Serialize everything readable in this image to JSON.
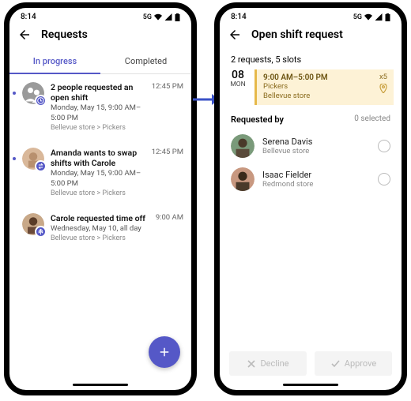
{
  "status": {
    "time": "8:14",
    "net": "5G"
  },
  "left": {
    "title": "Requests",
    "tabs": {
      "inprogress": "In progress",
      "completed": "Completed"
    },
    "items": [
      {
        "title": "2 people requested an open shift",
        "sub": "Monday, May 15, 9:00 AM–5:00 PM",
        "meta": "Bellevue store > Pickers",
        "time": "12:45 PM"
      },
      {
        "title": "Amanda wants to swap shifts with Carole",
        "sub": "Monday, May 15, 9:00 AM–5:00 PM",
        "meta": "Bellevue store > Pickers",
        "time": "12:45 PM"
      },
      {
        "title": "Carole requested time off",
        "sub": "Wednesday, May 10, all day",
        "meta": "Bellevue store > Pickers",
        "time": "9:00 AM"
      }
    ]
  },
  "right": {
    "title": "Open shift request",
    "summary": "2 requests, 5 slots",
    "shift": {
      "daynum": "08",
      "dayname": "MON",
      "time": "9:00 AM–5:00 PM",
      "team": "Pickers",
      "loc": "Bellevue store",
      "count": "x5"
    },
    "requested_by_label": "Requested by",
    "selected_label": "0 selected",
    "people": [
      {
        "name": "Serena Davis",
        "sub": "Bellevue store"
      },
      {
        "name": "Isaac Fielder",
        "sub": "Redmond store"
      }
    ],
    "decline": "Decline",
    "approve": "Approve"
  }
}
